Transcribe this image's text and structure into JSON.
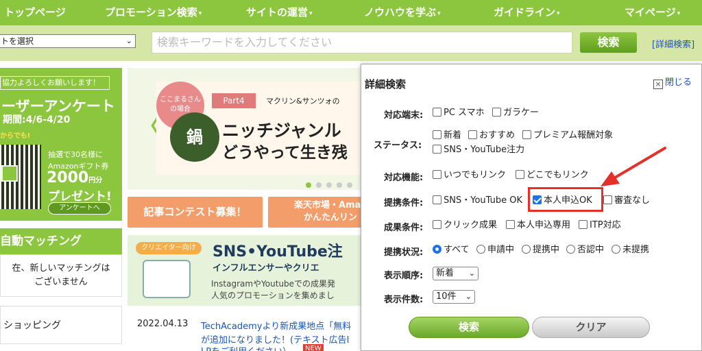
{
  "nav": {
    "items": [
      {
        "label": "トップページ",
        "caret": false
      },
      {
        "label": "プロモーション検索",
        "caret": true
      },
      {
        "label": "サイトの運営",
        "caret": true
      },
      {
        "label": "ノウハウを学ぶ",
        "caret": true
      },
      {
        "label": "ガイドライン",
        "caret": true
      },
      {
        "label": "マイページ",
        "caret": true
      }
    ],
    "caret_glyph": "▾"
  },
  "search": {
    "site_select_value": "トを選択",
    "keyword_placeholder": "検索キーワードを入力してください",
    "search_button": "検索",
    "advanced_link": "[詳細検索]"
  },
  "sidebar": {
    "banner": {
      "topline": "協力よろしくお願いします！",
      "title": "ーザーアンケート",
      "period": "期間:4/6-4/20",
      "cta": "からでも!",
      "prize_line1": "抽選で30名様に",
      "prize_line2": "Amazonギフト券",
      "amount": "2000",
      "amount_unit": "円分",
      "present": "プレゼント!",
      "button": "アンケートへ"
    },
    "auto_matching": {
      "heading": "自動マッチング",
      "line1": "在、新しいマッチングは",
      "line2": "ございません"
    },
    "shopping": "ショッピング"
  },
  "carousel": {
    "circle_line1": "ここまるさん",
    "circle_line2": "の場合",
    "logo_text": "鍋",
    "part": "Part4",
    "subtitle": "マクリン&サンツォの",
    "headline1": "ニッチジャンル",
    "headline2": "どうやって生き残",
    "arrow_glyph": "〈",
    "dots": 5,
    "active_dot": 0
  },
  "promo": {
    "contest": "記事コンテスト募集！",
    "rakuten_line1": "楽天市場・Amaz",
    "rakuten_line2": "かんたんリン"
  },
  "sns_banner": {
    "tag": "クリエイター向け",
    "title": "SNS•YouTube注",
    "subtitle": "インフルエンサーやクリエ",
    "text1": "InstagramやYoutubeでの成果発",
    "text2": "人気のプロモーションを集めまし"
  },
  "news": {
    "date": "2022.04.13",
    "line1": "TechAcademyより新成果地点「無料",
    "line2": "が追加になりました！(テキスト広告I",
    "line3": "LPをご利用ください）",
    "badge": "NEW"
  },
  "popup": {
    "title": "詳細検索",
    "close": "閉じる",
    "close_glyph": "×",
    "rows": {
      "device": {
        "label": "対応端末:",
        "options": [
          {
            "label": "PC スマホ",
            "checked": false
          },
          {
            "label": "ガラケー",
            "checked": false
          }
        ]
      },
      "status": {
        "label": "ステータス:",
        "options": [
          {
            "label": "新着",
            "checked": false
          },
          {
            "label": "おすすめ",
            "checked": false
          },
          {
            "label": "プレミアム報酬対象",
            "checked": false
          },
          {
            "label": "SNS・YouTube注力",
            "checked": false
          }
        ]
      },
      "feature": {
        "label": "対応機能:",
        "options": [
          {
            "label": "いつでもリンク",
            "checked": false
          },
          {
            "label": "どこでもリンク",
            "checked": false
          }
        ]
      },
      "condition": {
        "label": "提携条件:",
        "options": [
          {
            "label": "SNS・YouTube OK",
            "checked": false
          },
          {
            "label": "本人申込OK",
            "checked": true
          },
          {
            "label": "審査なし",
            "checked": false
          }
        ]
      },
      "result": {
        "label": "成果条件:",
        "options": [
          {
            "label": "クリック成果",
            "checked": false
          },
          {
            "label": "本人申込専用",
            "checked": false
          },
          {
            "label": "ITP対応",
            "checked": false
          }
        ]
      },
      "affiliation": {
        "label": "提携状況:",
        "options": [
          {
            "label": "すべて",
            "checked": true
          },
          {
            "label": "申請中",
            "checked": false
          },
          {
            "label": "提携中",
            "checked": false
          },
          {
            "label": "否認中",
            "checked": false
          },
          {
            "label": "未提携",
            "checked": false
          }
        ]
      },
      "order": {
        "label": "表示順序:",
        "value": "新着"
      },
      "count": {
        "label": "表示件数:",
        "value": "10件"
      }
    },
    "search_button": "検索",
    "clear_button": "クリア"
  },
  "select_arrow": "⌄",
  "colors": {
    "brand_green": "#8cc63f",
    "search_bg": "#d5e6a6",
    "annotation_red": "#e4302a",
    "link_blue": "#1a55b8",
    "check_blue": "#1a73e8"
  }
}
